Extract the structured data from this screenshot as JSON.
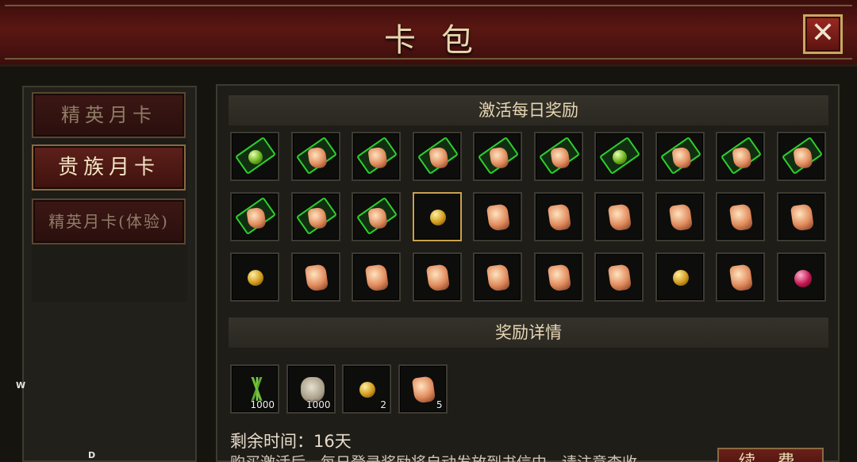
{
  "window": {
    "title": "卡包",
    "close_icon": "close-x-icon"
  },
  "sidebar": {
    "tabs": [
      {
        "label": "精英月卡",
        "active": false
      },
      {
        "label": "贵族月卡",
        "active": true
      },
      {
        "label": "精英月卡(体验)",
        "active": false
      }
    ]
  },
  "daily_rewards": {
    "header": "激活每日奖励",
    "rows": [
      [
        "ticket-orb",
        "ticket-crystal",
        "ticket-crystal",
        "ticket-crystal",
        "ticket-crystal",
        "ticket-crystal",
        "ticket-orb",
        "ticket-crystal",
        "ticket-crystal",
        "ticket-crystal"
      ],
      [
        "ticket-crystal",
        "ticket-crystal",
        "ticket-crystal",
        "gold-orb",
        "crystal",
        "crystal",
        "crystal",
        "crystal",
        "crystal",
        "crystal"
      ],
      [
        "gold-orb",
        "crystal",
        "crystal",
        "crystal",
        "crystal",
        "crystal",
        "crystal",
        "gold-orb",
        "crystal",
        "ruby-gem"
      ]
    ],
    "selected": [
      1,
      3
    ]
  },
  "reward_details": {
    "header": "奖励详情",
    "items": [
      {
        "icon": "grass-icon",
        "qty": "1000"
      },
      {
        "icon": "pouch-icon",
        "qty": "1000"
      },
      {
        "icon": "gold-orb-icon",
        "qty": "2"
      },
      {
        "icon": "crystal-icon",
        "qty": "5"
      }
    ]
  },
  "remaining_time": "剩余时间：16天",
  "notice": "购买激活后，每日登录奖励将自动发放到书信中，请注意查收",
  "buy_button": "续 费",
  "edge_labels": {
    "w": "W",
    "d": "D"
  }
}
